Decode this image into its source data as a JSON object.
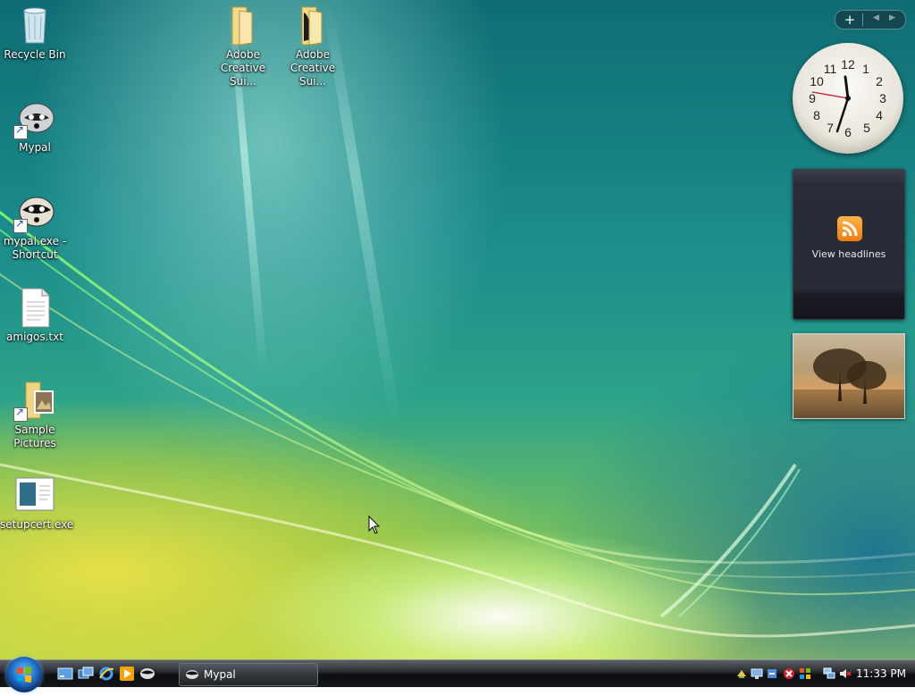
{
  "desktop": {
    "icons": [
      {
        "label": "Recycle Bin"
      },
      {
        "label": "Mypal"
      },
      {
        "label": "mypal.exe - Shortcut"
      },
      {
        "label": "amigos.txt"
      },
      {
        "label": "Sample Pictures"
      },
      {
        "label": "setupcert.exe"
      },
      {
        "label": "Adobe Creative Sui..."
      },
      {
        "label": "Adobe Creative Sui..."
      }
    ]
  },
  "sidebar": {
    "add_label": "+",
    "clock": {
      "numbers": [
        "12",
        "1",
        "2",
        "3",
        "4",
        "5",
        "6",
        "7",
        "8",
        "9",
        "10",
        "11"
      ],
      "time": "11:33"
    },
    "feed": {
      "text": "View headlines",
      "icon": "rss-icon"
    },
    "slideshow": {
      "subject": "trees at sunset photo"
    }
  },
  "taskbar": {
    "start_icon": "windows-orb-icon",
    "quick_launch": [
      "show-desktop-icon",
      "switch-windows-icon",
      "internet-explorer-icon",
      "media-player-icon",
      "mypal-icon"
    ],
    "tasks": [
      {
        "label": "Mypal"
      }
    ],
    "tray_icons": [
      "network-sync-icon",
      "display-icon",
      "update-icon",
      "security-alert-icon",
      "windows-flag-icon",
      "network-icon",
      "volume-muted-icon"
    ],
    "clock": "11:33 PM"
  },
  "colors": {
    "accent": "#1e6fc9",
    "rss": "#f07a10",
    "desktop": "#1b8b8b"
  }
}
